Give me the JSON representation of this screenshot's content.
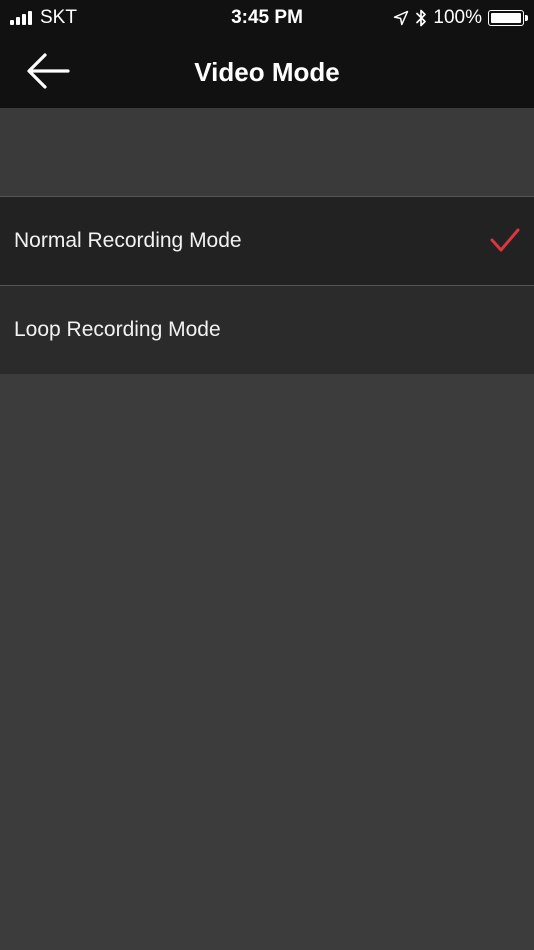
{
  "status_bar": {
    "carrier": "SKT",
    "time": "3:45 PM",
    "battery_percent": "100%",
    "battery_level": 1.0,
    "icons": [
      "signal-icon",
      "location-arrow-icon",
      "bluetooth-icon",
      "battery-icon"
    ]
  },
  "nav": {
    "title": "Video Mode",
    "back_icon": "back-arrow-icon"
  },
  "options": [
    {
      "label": "Normal Recording Mode",
      "selected": true
    },
    {
      "label": "Loop Recording Mode",
      "selected": false
    }
  ],
  "colors": {
    "accent_check": "#d9363e",
    "nav_background": "#111111",
    "content_background": "#3c3c3c"
  }
}
